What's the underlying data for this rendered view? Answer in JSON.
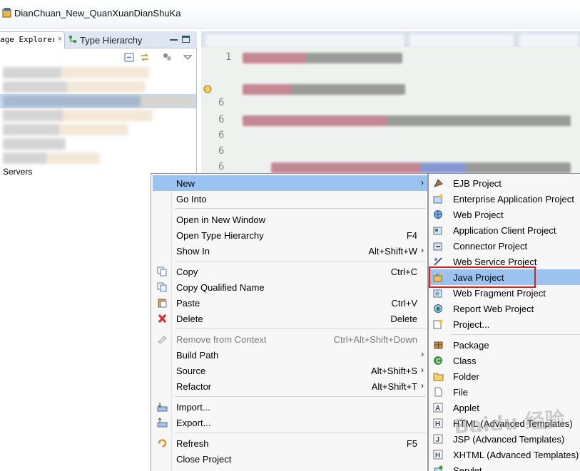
{
  "window": {
    "title": "DianChuan_New_QuanXuanDianShuKa"
  },
  "left_view": {
    "tabs": [
      {
        "label": "age Explorer",
        "close": "×",
        "icon": "package-explorer-icon"
      },
      {
        "label": "Type Hierarchy",
        "icon": "type-hierarchy-icon"
      }
    ],
    "tree_items": [
      "Servers"
    ]
  },
  "context_menu": {
    "items": [
      {
        "label": "New",
        "shortcut": "",
        "submenu": true,
        "highlighted": true
      },
      {
        "label": "Go Into",
        "shortcut": ""
      },
      {
        "label": "Open in New Window",
        "shortcut": ""
      },
      {
        "label": "Open Type Hierarchy",
        "shortcut": "F4"
      },
      {
        "label": "Show In",
        "shortcut": "Alt+Shift+W",
        "submenu": true
      },
      {
        "label": "Copy",
        "shortcut": "Ctrl+C",
        "icon": "copy-icon"
      },
      {
        "label": "Copy Qualified Name",
        "shortcut": "",
        "icon": "copy-qualified-icon"
      },
      {
        "label": "Paste",
        "shortcut": "Ctrl+V",
        "icon": "paste-icon"
      },
      {
        "label": "Delete",
        "shortcut": "Delete",
        "icon": "delete-icon"
      },
      {
        "label": "Remove from Context",
        "shortcut": "Ctrl+Alt+Shift+Down",
        "disabled": true,
        "icon": "remove-context-icon"
      },
      {
        "label": "Build Path",
        "shortcut": "",
        "submenu": true
      },
      {
        "label": "Source",
        "shortcut": "Alt+Shift+S",
        "submenu": true
      },
      {
        "label": "Refactor",
        "shortcut": "Alt+Shift+T",
        "submenu": true
      },
      {
        "label": "Import...",
        "shortcut": "",
        "icon": "import-icon"
      },
      {
        "label": "Export...",
        "shortcut": "",
        "icon": "export-icon"
      },
      {
        "label": "Refresh",
        "shortcut": "F5",
        "icon": "refresh-icon"
      },
      {
        "label": "Close Project",
        "shortcut": ""
      }
    ],
    "arrow": "›"
  },
  "new_submenu": {
    "items": [
      {
        "label": "EJB Project",
        "icon": "ejb-project-icon"
      },
      {
        "label": "Enterprise Application Project",
        "icon": "enterprise-app-icon"
      },
      {
        "label": "Web Project",
        "icon": "web-project-icon"
      },
      {
        "label": "Application Client Project",
        "icon": "app-client-icon"
      },
      {
        "label": "Connector Project",
        "icon": "connector-project-icon"
      },
      {
        "label": "Web Service Project",
        "icon": "web-service-icon"
      },
      {
        "label": "Java Project",
        "icon": "java-project-icon",
        "highlighted": true
      },
      {
        "label": "Web Fragment Project",
        "icon": "web-fragment-icon"
      },
      {
        "label": "Report Web Project",
        "icon": "report-web-icon"
      },
      {
        "label": "Project...",
        "icon": "project-icon"
      },
      {
        "label": "Package",
        "icon": "package-icon"
      },
      {
        "label": "Class",
        "icon": "class-icon"
      },
      {
        "label": "Folder",
        "icon": "folder-icon"
      },
      {
        "label": "File",
        "icon": "file-icon"
      },
      {
        "label": "Applet",
        "icon": "applet-icon"
      },
      {
        "label": "HTML (Advanced Templates)",
        "icon": "html-icon"
      },
      {
        "label": "JSP (Advanced Templates)",
        "icon": "jsp-icon"
      },
      {
        "label": "XHTML (Advanced Templates)",
        "icon": "xhtml-icon"
      },
      {
        "label": "Servlet",
        "icon": "servlet-icon"
      }
    ]
  },
  "editor": {
    "line_numbers": [
      "1",
      "",
      "6",
      "6",
      "6",
      "6",
      "6"
    ]
  },
  "watermark": "Baidu 经验",
  "colors": {
    "highlight": "#9ac4ef",
    "callout": "#e02020",
    "selection": "#c7daf0"
  }
}
